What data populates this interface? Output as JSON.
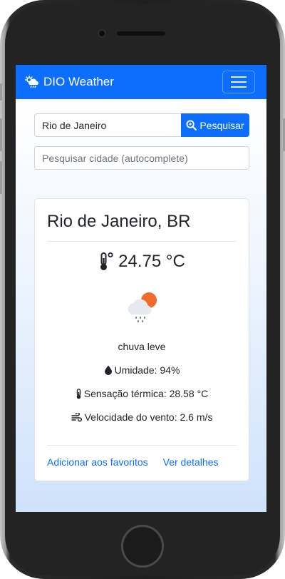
{
  "navbar": {
    "brand_icon": "cloud-sun-rain-icon",
    "brand": "DIO Weather",
    "toggler_icon": "hamburger-menu-icon"
  },
  "search": {
    "value": "Rio de Janeiro",
    "button_icon": "search-icon",
    "button_label": "Pesquisar",
    "autocomplete_placeholder": "Pesquisar cidade (autocomplete)"
  },
  "weather": {
    "city": "Rio de Janeiro, BR",
    "temperature_icon": "thermometer-icon",
    "temperature": "24.75 °C",
    "condition_icon": "light-rain-day-icon",
    "description": "chuva leve",
    "humidity_icon": "droplet-icon",
    "humidity": "Umidade: 94%",
    "feels_like_icon": "thermometer-small-icon",
    "feels_like": "Sensação térmica: 28.58 °C",
    "wind_icon": "wind-icon",
    "wind": "Velocidade do vento: 2.6 m/s"
  },
  "actions": {
    "favorite": "Adicionar aos favoritos",
    "details": "Ver detalhes"
  },
  "colors": {
    "primary": "#0d6efd",
    "sun": "#f26a2e",
    "cloud": "#e6e9ee"
  }
}
